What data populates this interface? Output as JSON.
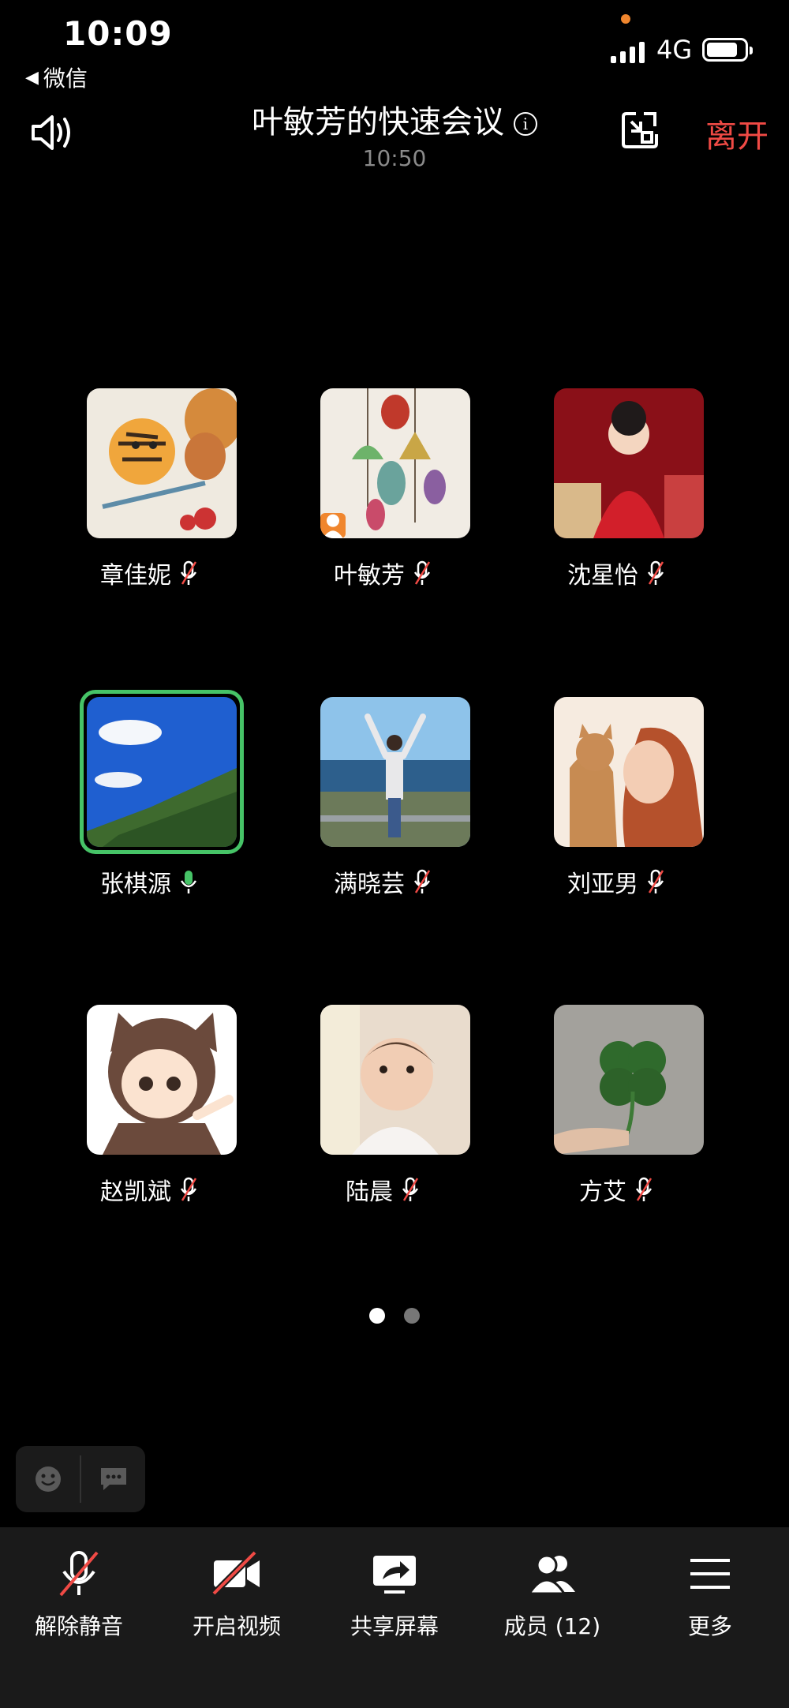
{
  "status_bar": {
    "time": "10:09",
    "back_app": "微信",
    "network": "4G"
  },
  "header": {
    "title": "叶敏芳的快速会议",
    "info_glyph": "i",
    "meeting_time": "10:50",
    "leave": "离开"
  },
  "participants": [
    {
      "name": "章佳妮",
      "mic": "muted",
      "avatar": "tiger-butterfly-illustration"
    },
    {
      "name": "叶敏芳",
      "mic": "muted",
      "avatar": "wind-bells-photo",
      "host": true
    },
    {
      "name": "沈星怡",
      "mic": "muted",
      "avatar": "girl-red-dress-photo"
    },
    {
      "name": "张棋源",
      "mic": "on",
      "avatar": "sky-mountain-photo",
      "speaking": true
    },
    {
      "name": "满晓芸",
      "mic": "muted",
      "avatar": "woman-seaside-photo"
    },
    {
      "name": "刘亚男",
      "mic": "muted",
      "avatar": "woman-cat-illustration"
    },
    {
      "name": "赵凯斌",
      "mic": "muted",
      "avatar": "cat-hood-boy-illustration"
    },
    {
      "name": "陆晨",
      "mic": "muted",
      "avatar": "toddler-photo"
    },
    {
      "name": "方艾",
      "mic": "muted",
      "avatar": "four-leaf-clover-photo"
    }
  ],
  "pagination": {
    "pages": 2,
    "current": 1
  },
  "toolbar": {
    "unmute": "解除静音",
    "video": "开启视频",
    "share": "共享屏幕",
    "members": "成员 (12)",
    "more": "更多"
  },
  "colors": {
    "leave": "#f04a45",
    "speaking": "#46c367",
    "host_badge": "#f0862e",
    "toolbar_bg": "#1a1a1a"
  }
}
